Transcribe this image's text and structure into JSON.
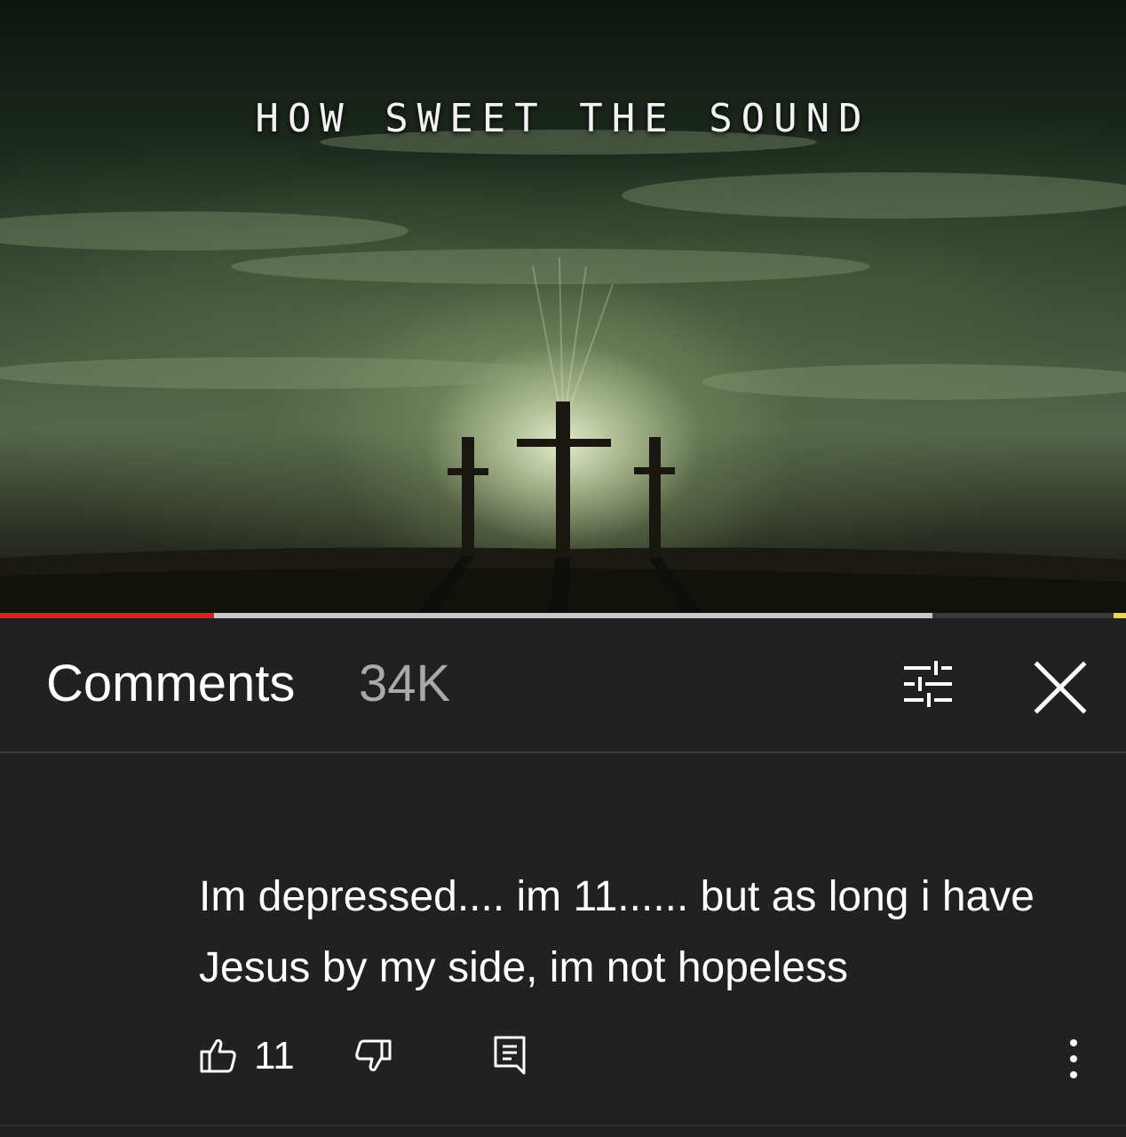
{
  "video": {
    "title_card": "HOW SWEET THE SOUND",
    "progress": {
      "played_fraction": 0.19,
      "buffered_fraction": 0.828
    }
  },
  "comments_panel": {
    "title": "Comments",
    "count": "34K",
    "icons": {
      "sort": "sort-filter-icon",
      "close": "close-icon"
    }
  },
  "comment": {
    "text": "Im depressed.... im 11...... but as long i have Jesus by my side, im not hopeless",
    "like_count": "11",
    "icons": {
      "like": "thumbs-up-icon",
      "dislike": "thumbs-down-icon",
      "reply": "reply-comment-icon",
      "more": "more-vertical-icon"
    }
  },
  "colors": {
    "background": "#212121",
    "progress_played": "#e01e1e",
    "progress_buffered": "#c9c9c9",
    "count_text": "#aaaaaa"
  }
}
